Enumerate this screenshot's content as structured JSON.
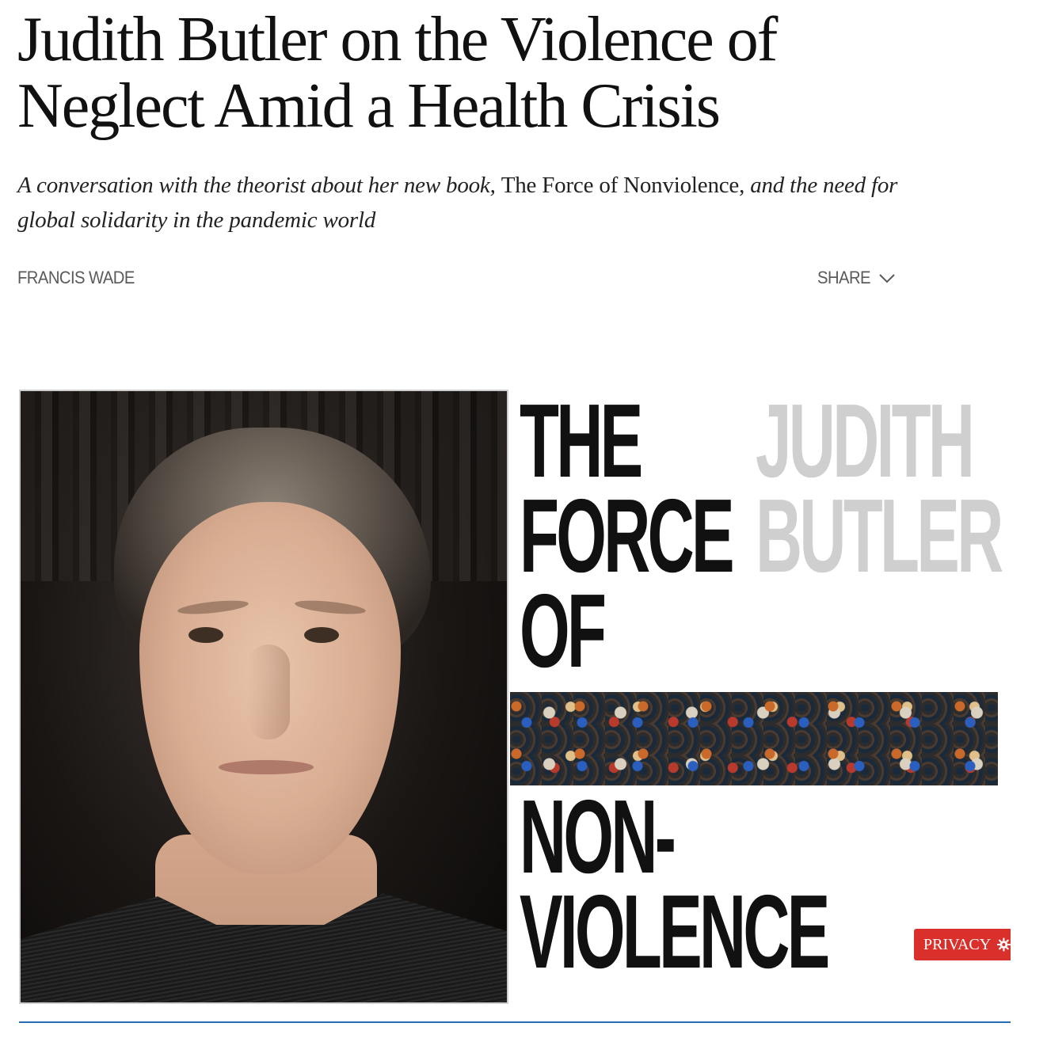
{
  "article": {
    "headline": "Judith Butler on the Violence of Neglect Amid a Health Crisis",
    "dek": {
      "part1": "A conversation with the theorist about her new book, ",
      "book_title": "The Force of Nonviolence,",
      "part2": " and the need for global solidarity in the pandemic world"
    },
    "byline": "FRANCIS WADE",
    "share_label": "SHARE"
  },
  "hero_image": {
    "cover_title_lines": [
      "THE",
      "FORCE",
      "OF",
      "NON-",
      "VIOLENCE"
    ],
    "cover_author_lines": [
      "JUDITH",
      "BUTLER"
    ]
  },
  "privacy_button": {
    "label": "PRIVACY"
  },
  "colors": {
    "privacy_bg": "#d9302c",
    "rule": "#2a6bb5",
    "author_grey": "#cfcfcf"
  },
  "icons": {
    "share": "chevron-down-icon",
    "privacy": "gear-icon"
  }
}
